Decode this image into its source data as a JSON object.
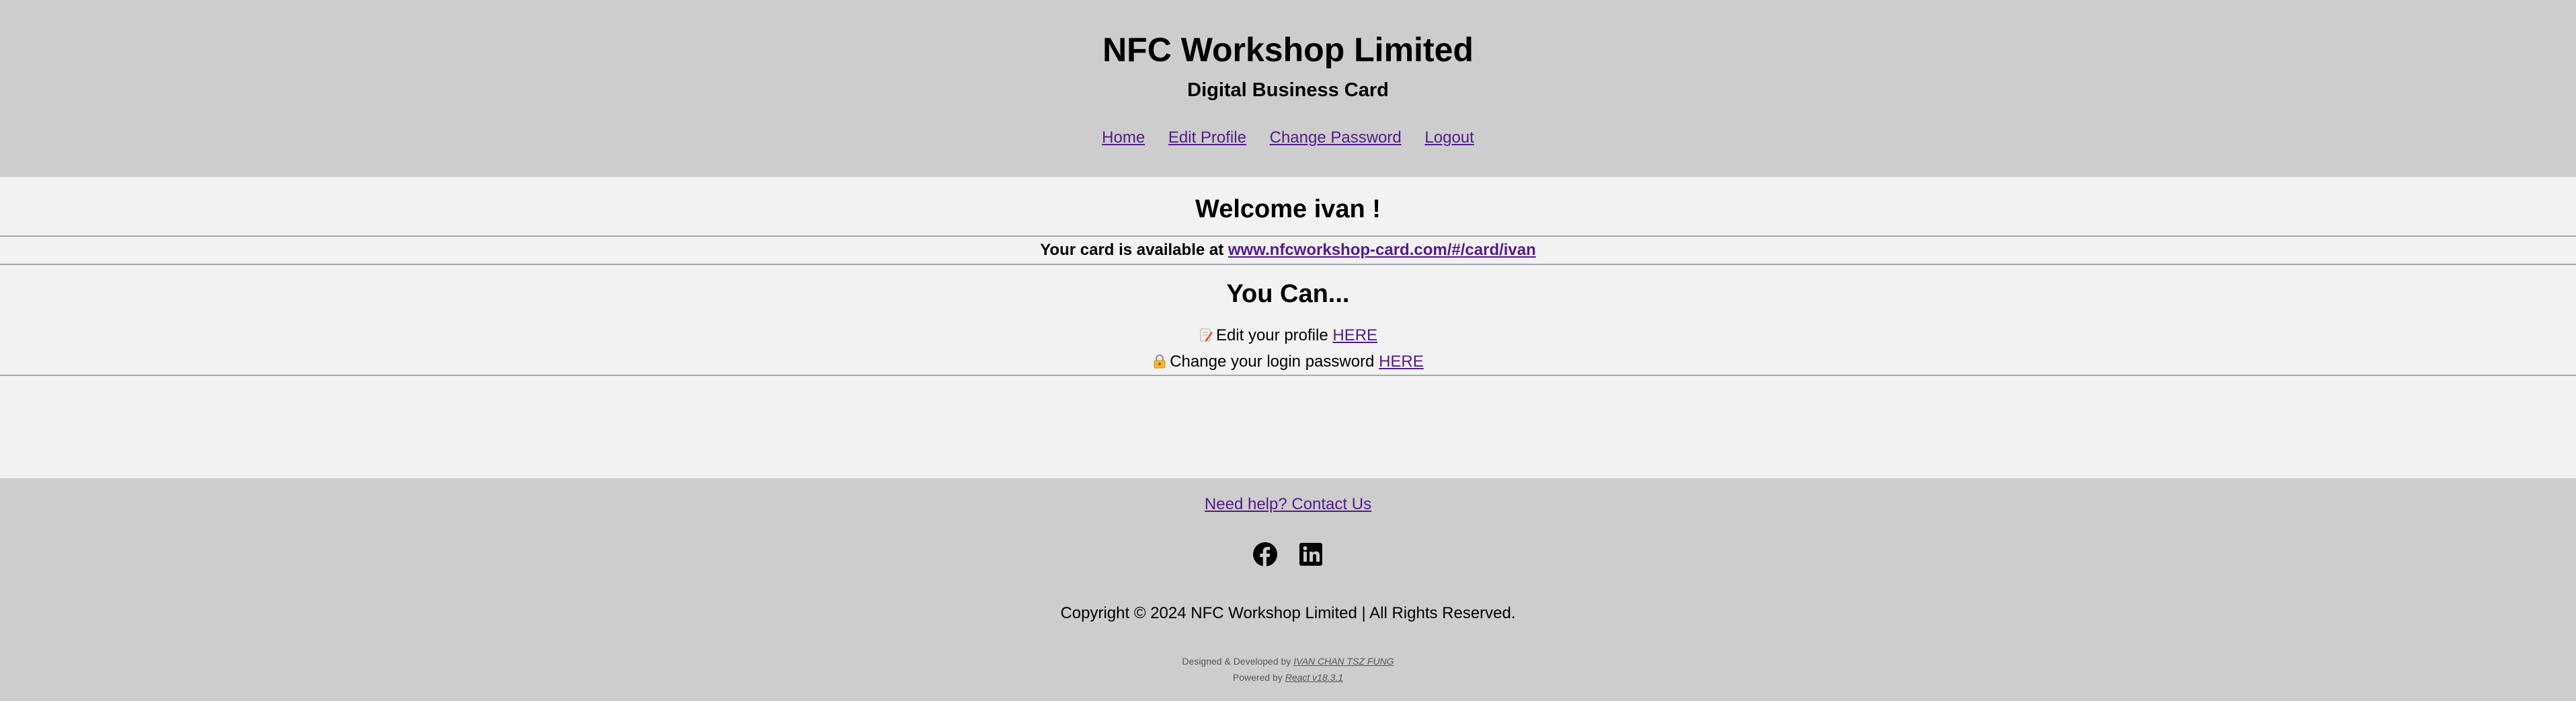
{
  "header": {
    "company": "NFC Workshop Limited",
    "subtitle": "Digital Business Card",
    "nav": [
      "Home",
      "Edit Profile",
      "Change Password",
      "Logout"
    ]
  },
  "main": {
    "welcome": "Welcome ivan !",
    "card_prefix": "Your card is available at",
    "card_link": "www.nfcworkshop-card.com/#/card/ivan",
    "you_can": "You Can...",
    "actions": [
      {
        "icon": "memo-icon",
        "text": "Edit your profile",
        "link": "HERE"
      },
      {
        "icon": "lock-icon",
        "text": "Change your login password",
        "link": "HERE"
      }
    ]
  },
  "footer": {
    "help": "Need help? Contact Us",
    "social_icons": [
      "facebook-icon",
      "linkedin-icon"
    ],
    "copyright": "Copyright © 2024 NFC Workshop Limited | All Rights Reserved.",
    "designed_prefix": "Designed & Developed by",
    "designer": "IVAN CHAN TSZ FUNG",
    "powered_prefix": "Powered by",
    "powered": "React v18.3.1"
  },
  "colors": {
    "header_bg": "#cdcdcd",
    "main_bg": "#f2f2f2",
    "link": "#551a8b"
  }
}
